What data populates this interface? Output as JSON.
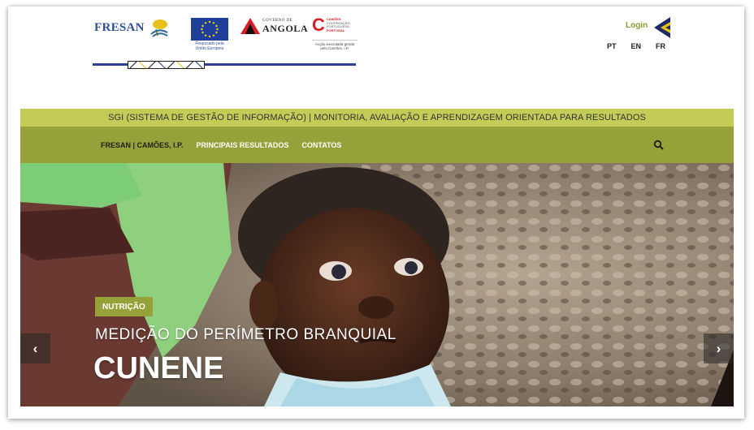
{
  "header": {
    "brand_logo_text": "FRESAN",
    "eu_caption": "Financiado pela União Europeia",
    "angola_small": "GOVERNO DE",
    "angola_big": "ANGOLA",
    "camoes_lines": [
      "CAMÕES",
      "COOPERAÇÃO",
      "PORTUGUESA",
      "PORTUGAL"
    ],
    "camoes_caption": "Acção executada gerida pelo Camões, I.P.",
    "login_label": "Login",
    "languages": [
      "PT",
      "EN",
      "FR"
    ]
  },
  "topbar": {
    "text": "SGI (SISTEMA DE GESTÃO DE INFORMAÇÃO) | MONITORIA, AVALIAÇÃO E APRENDIZAGEM ORIENTADA PARA RESULTADOS"
  },
  "nav": {
    "items": [
      "FRESAN | CAMÕES, I.P.",
      "PRINCIPAIS RESULTADOS",
      "CONTATOS"
    ],
    "search_icon": "search-icon"
  },
  "hero": {
    "category": "NUTRIÇÃO",
    "subtitle": "MEDIÇÃO DO PERÍMETRO BRANQUIAL",
    "title": "CUNENE",
    "prev_icon": "‹",
    "next_icon": "›"
  },
  "colors": {
    "topbar": "#c4cc57",
    "navbar": "#97a13a",
    "accent": "#8a9a2e",
    "brand_blue": "#2d4f9a"
  }
}
